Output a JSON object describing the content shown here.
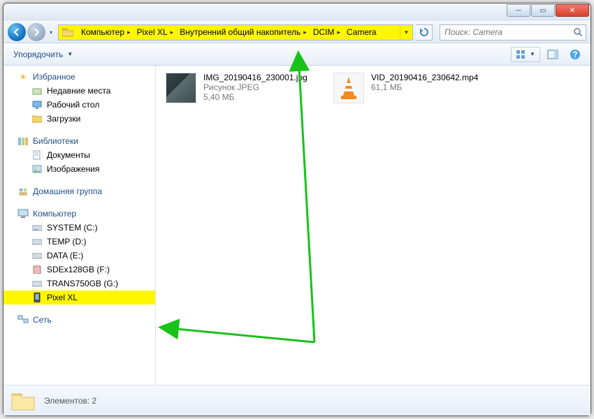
{
  "breadcrumb": [
    "Компьютер",
    "Pixel XL",
    "Внутренний общий накопитель",
    "DCIM",
    "Camera"
  ],
  "search": {
    "placeholder": "Поиск: Camera"
  },
  "toolbar": {
    "organize": "Упорядочить"
  },
  "sidebar": {
    "favorites": {
      "title": "Избранное",
      "items": [
        "Недавние места",
        "Рабочий стол",
        "Загрузки"
      ]
    },
    "libraries": {
      "title": "Библиотеки",
      "items": [
        "Документы",
        "Изображения"
      ]
    },
    "homegroup": {
      "title": "Домашняя группа"
    },
    "computer": {
      "title": "Компьютер",
      "drives": [
        "SYSTEM (C:)",
        "TEMP (D:)",
        "DATA (E:)",
        "SDEx128GB (F:)",
        "TRANS750GB (G:)",
        "Pixel XL"
      ]
    },
    "network": {
      "title": "Сеть"
    }
  },
  "files": [
    {
      "name": "IMG_20190416_230001.jpg",
      "type": "Рисунок JPEG",
      "size": "5,40 МБ",
      "kind": "image"
    },
    {
      "name": "VID_20190416_230642.mp4",
      "type": "",
      "size": "61,1 МБ",
      "kind": "video"
    }
  ],
  "status": {
    "text": "Элементов: 2"
  }
}
